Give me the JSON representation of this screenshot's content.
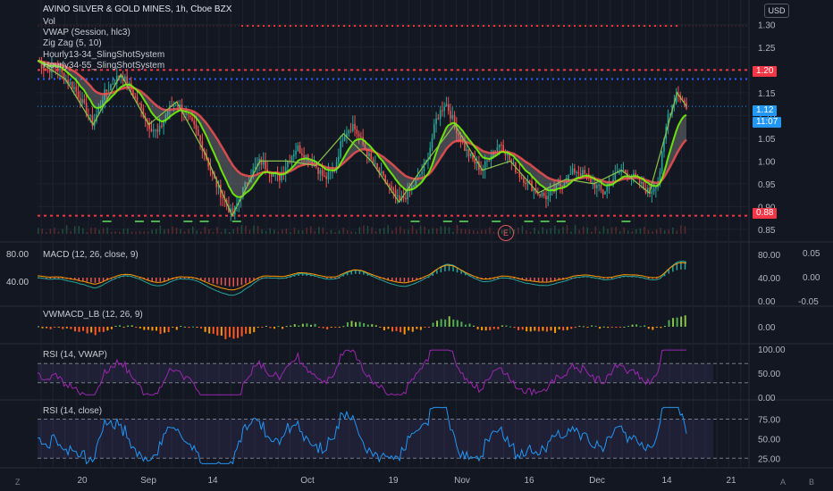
{
  "header": {
    "title": "AVINO SILVER & GOLD MINES, 1h, Cboe BZX",
    "currency": "USD",
    "legend": [
      "Vol",
      "VWAP (Session, hlc3)",
      "Zig Zag (5, 10)",
      "Hourly13-34_SlingShotSystem",
      "Hourly34-55_SlingShotSystem"
    ]
  },
  "price_tags": {
    "upper": "1.20",
    "last": "1.12",
    "countdown": "11:07",
    "lower": "0.88"
  },
  "earnings_marker": "E",
  "panes": {
    "macd": {
      "title": "MACD (12, 26, close, 9)",
      "left_tick": "80.00",
      "left_tick2": "40.00"
    },
    "vwmacd": {
      "title": "VWMACD_LB (12, 26, 9)"
    },
    "rsi_vwap": {
      "title": "RSI (14, VWAP)"
    },
    "rsi_close": {
      "title": "RSI (14, close)"
    }
  },
  "corner_buttons": {
    "left": "Z",
    "a": "A",
    "b": "B"
  },
  "colors": {
    "background": "#131722",
    "up": "#26a69a",
    "down": "#ef5350",
    "zigzag": "#8bc34a",
    "sling_fast": "#76ff03",
    "sling_slow": "#ff5252",
    "rsi_vwap": "#9c27b0",
    "rsi_close": "#2196f3",
    "last_price": "#2196f3",
    "level": "#f23645"
  },
  "chart_data": [
    {
      "type": "line",
      "name": "price",
      "title": "AVINO SILVER & GOLD MINES, 1h, Cboe BZX",
      "x_ticks": [
        "20",
        "Sep",
        "14",
        "Oct",
        "19",
        "Nov",
        "16",
        "Dec",
        "14",
        "21"
      ],
      "y_ticks": [
        0.85,
        0.9,
        0.95,
        1.0,
        1.05,
        1.1,
        1.15,
        1.2,
        1.25,
        1.3
      ],
      "ylim": [
        0.84,
        1.33
      ],
      "horizontal_levels": [
        1.2,
        1.18,
        0.88
      ],
      "close": [
        1.22,
        1.2,
        1.21,
        1.18,
        1.16,
        1.12,
        1.08,
        1.14,
        1.17,
        1.19,
        1.16,
        1.12,
        1.08,
        1.06,
        1.11,
        1.13,
        1.1,
        1.07,
        1.02,
        0.96,
        0.92,
        0.88,
        0.93,
        0.97,
        1.0,
        0.98,
        0.96,
        1.0,
        1.03,
        1.01,
        0.99,
        0.96,
        0.98,
        1.06,
        1.08,
        1.04,
        1.0,
        0.97,
        0.94,
        0.91,
        0.93,
        0.96,
        1.0,
        1.09,
        1.13,
        1.08,
        1.03,
        1.0,
        0.98,
        1.02,
        1.04,
        1.0,
        0.97,
        0.95,
        0.93,
        0.92,
        0.94,
        0.96,
        0.98,
        0.97,
        0.95,
        0.93,
        0.96,
        0.98,
        0.97,
        0.95,
        0.93,
        0.96,
        1.1,
        1.15,
        1.12
      ]
    },
    {
      "type": "bar",
      "name": "MACD",
      "title": "MACD (12, 26, close, 9)",
      "y_ticks": [
        0.0,
        40.0,
        80.0
      ],
      "y_ticks_right": [
        -0.05,
        0.0,
        0.05
      ],
      "ylim": [
        -0.06,
        0.06
      ]
    },
    {
      "type": "bar",
      "name": "VWMACD",
      "title": "VWMACD_LB (12, 26, 9)",
      "y_ticks": [
        0.0
      ]
    },
    {
      "type": "line",
      "name": "RSI VWAP",
      "title": "RSI (14, VWAP)",
      "y_ticks": [
        0.0,
        50.0,
        100.0
      ],
      "ylim": [
        0,
        100
      ],
      "bands": [
        70,
        30
      ]
    },
    {
      "type": "line",
      "name": "RSI close",
      "title": "RSI (14, close)",
      "y_ticks": [
        25.0,
        50.0,
        75.0
      ],
      "ylim": [
        15,
        95
      ],
      "bands": [
        75,
        25
      ]
    }
  ]
}
